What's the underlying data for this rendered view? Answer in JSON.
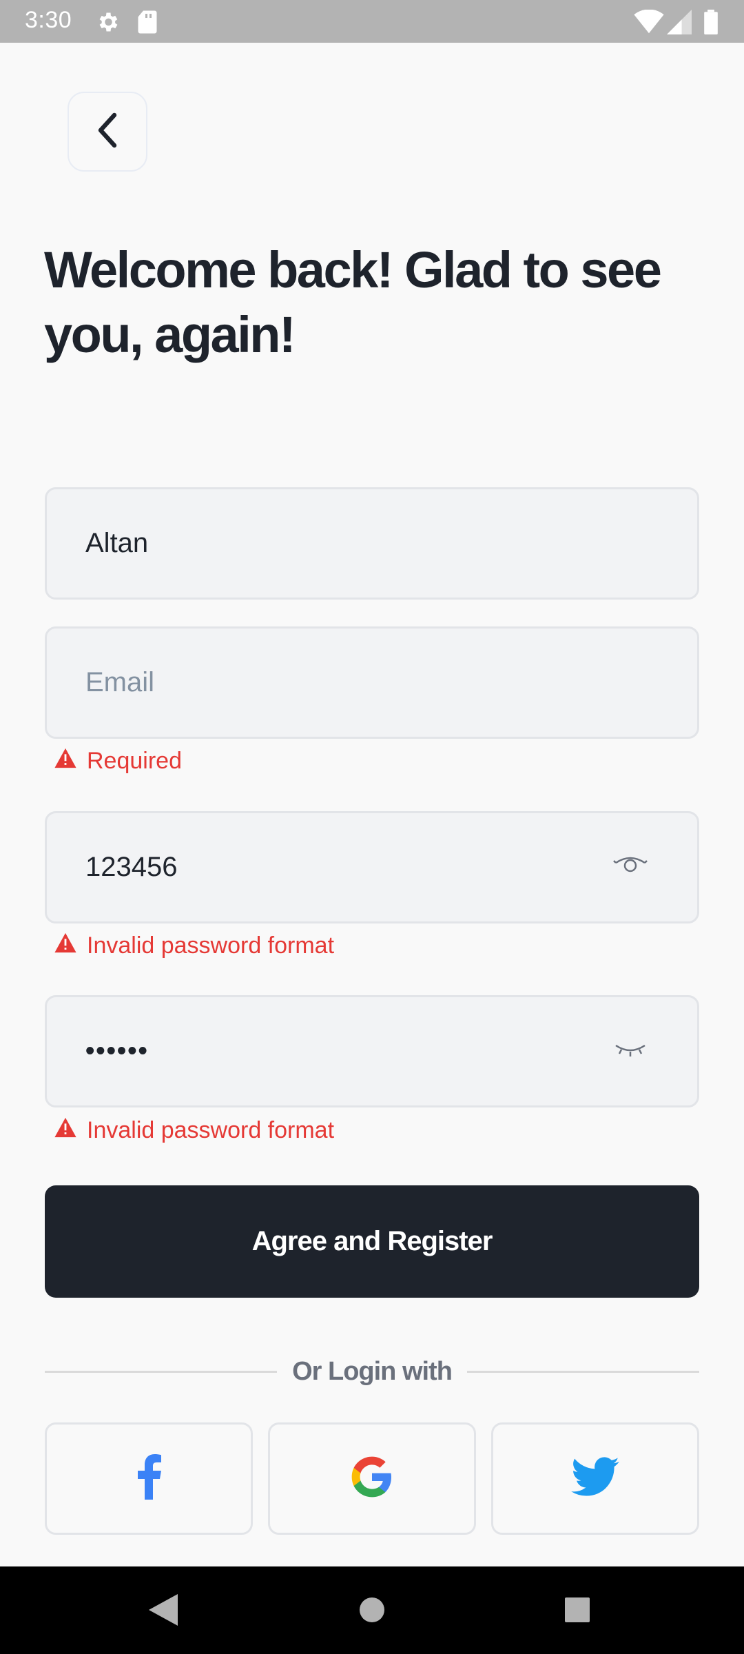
{
  "status_bar": {
    "time": "3:30",
    "icons": [
      "settings-icon",
      "sd-card-icon",
      "wifi-icon",
      "signal-icon",
      "battery-icon"
    ]
  },
  "header": {
    "back_icon": "chevron-left-icon",
    "title": "Welcome back! Glad to see you, again!"
  },
  "form": {
    "username": {
      "value": "Altan"
    },
    "email": {
      "value": "",
      "placeholder": "Email",
      "error": "Required"
    },
    "password": {
      "value": "123456",
      "visibility_icon": "eye-open-icon",
      "error": "Invalid password format"
    },
    "confirm_password": {
      "value": "••••••",
      "visibility_icon": "eye-closed-icon",
      "error": "Invalid password format"
    },
    "submit_label": "Agree and Register"
  },
  "social_login": {
    "divider_label": "Or Login with",
    "providers": [
      "facebook-icon",
      "google-icon",
      "twitter-icon"
    ]
  },
  "colors": {
    "primary": "#1e232c",
    "error": "#e53935",
    "field_bg": "#f2f3f5",
    "facebook": "#3b82f6",
    "twitter": "#1d9bf0"
  }
}
